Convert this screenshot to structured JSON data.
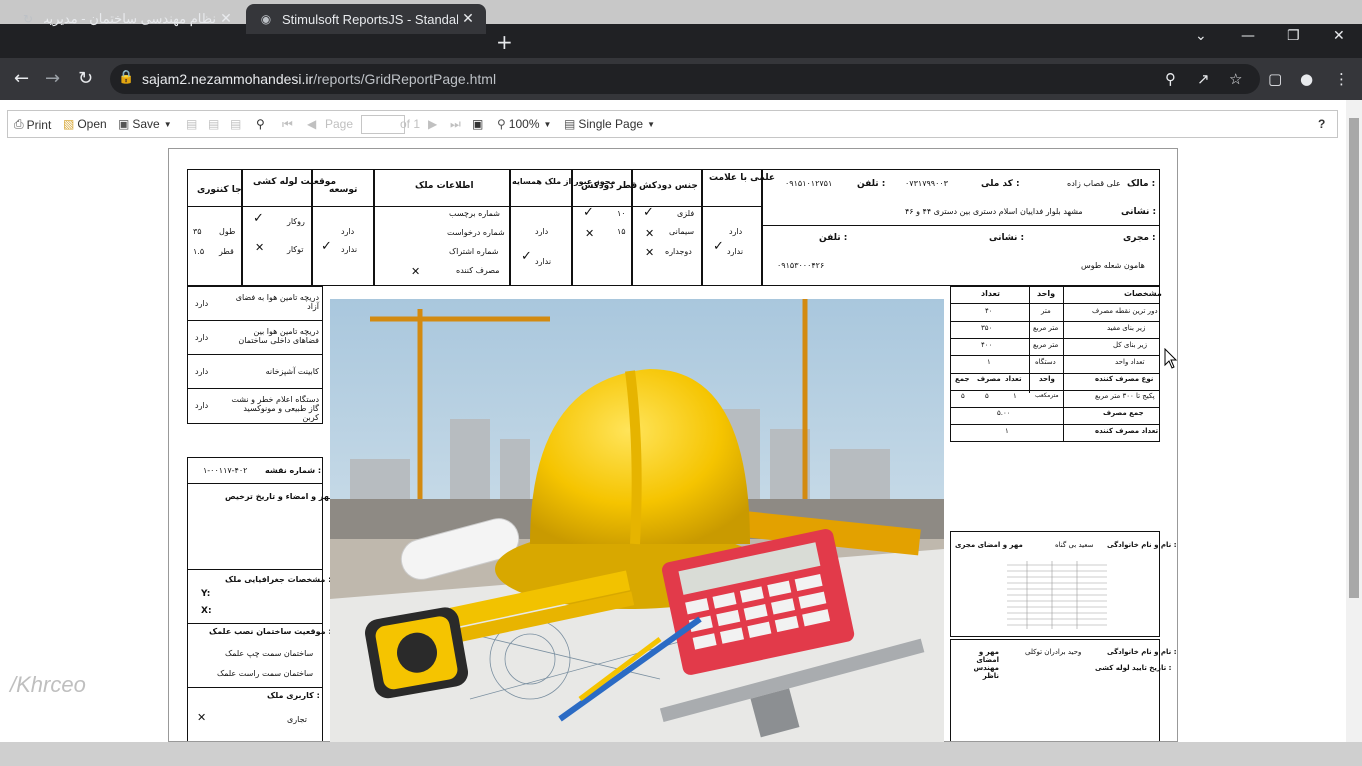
{
  "browser": {
    "tabs": [
      {
        "title": "نظام مهندسی ساختمان - مدیریت پ",
        "active": false
      },
      {
        "title": "Stimulsoft ReportsJS - Standalone",
        "active": true
      }
    ],
    "new_tab": "+",
    "url_domain": "sajam2.nezammohandesi.ir",
    "url_path": "/reports/GridReportPage.html"
  },
  "toolbar": {
    "print": "Print",
    "open": "Open",
    "save": "Save",
    "page_label": "Page",
    "page_value": "",
    "page_of": "of 1",
    "zoom": "100%",
    "view_mode": "Single Page",
    "help": "?"
  },
  "report": {
    "owner": {
      "owner_label": "مالک :",
      "owner_value": "علی قصاب زاده",
      "national_id_label": "کد ملی :",
      "national_id_value": "۰۷۳۱۷۹۹۰۰۳",
      "phone_label": "تلفن :",
      "phone_value": "۰۹۱۵۱۰۱۲۷۵۱",
      "address_label": "نشانی :",
      "address_value": "مشهد بلوار فداییان اسلام دستری بین دستری ۴۴ و ۴۶"
    },
    "executor": {
      "executor_label": "مجری :",
      "executor_value": "هامون شعله طوس",
      "address_label": "نشانی :",
      "phone_label": "تلفن :",
      "phone_value": "۰۹۱۵۳۰۰۰۴۲۶"
    },
    "headers": {
      "sign": "علمی با علامت",
      "chimney_type": "جنس دودکش",
      "chimney_diameter": "قطر دودکش",
      "neighbor_permit": "مجوز عبور از ملک همسایه",
      "property_info": "اطلاعات ملک",
      "development": "توسعه",
      "pipe_position": "موقعیت لوله کشی",
      "meter_place": "جا کنتوری"
    },
    "values": {
      "has": "دارد",
      "has_not": "ندارد",
      "metal": "فلزی",
      "cement": "سیمانی",
      "double_wall": "دوجداره",
      "d10": "۱۰",
      "d15": "۱۵",
      "tag_no": "شماره برچسب",
      "request_no": "شماره درخواست",
      "subscription_no": "شماره اشتراک",
      "consumer": "مصرف کننده",
      "surface": "روکار",
      "concealed": "توکار",
      "length_label": "طول",
      "length_value": "۳۵",
      "diameter_label": "قطر",
      "diameter_value": "۱.۵"
    },
    "specs": {
      "title": "مشخصات",
      "unit": "واحد",
      "count": "تعداد",
      "rows": [
        {
          "label": "دور ترین نقطه مصرف",
          "unit": "متر",
          "value": "۴۰"
        },
        {
          "label": "زیر بنای مفید",
          "unit": "متر مربع",
          "value": "۳۵۰"
        },
        {
          "label": "زیر بنای کل",
          "unit": "متر مربع",
          "value": "۴۰۰"
        },
        {
          "label": "تعداد واحد",
          "unit": "دستگاه",
          "value": "۱"
        }
      ],
      "consumer_type": "نوع مصرف کننده",
      "sum": "جمع",
      "usage": "مصرف",
      "package_label": "پکیج تا ۳۰۰ متر مربع",
      "package_unit": "مترمکعب",
      "package_count": "۱",
      "package_usage": "۵",
      "package_sum": "۵",
      "total_usage_label": "جمع مصرف",
      "total_usage_value": "۵.۰۰",
      "consumer_count_label": "تعداد مصرف کننده",
      "consumer_count_value": "۱"
    },
    "left_list": [
      {
        "label": "دریچه تامین هوا به فضای آزاد",
        "value": "دارد"
      },
      {
        "label": "دریچه تامین هوا بین فضاهای داخلی ساختمان",
        "value": "دارد"
      },
      {
        "label": "کابینت آشپزخانه",
        "value": "دارد"
      },
      {
        "label": "دستگاه اعلام خطر و نشت گاز طبیعی و مونوکسید کربن",
        "value": "دارد"
      }
    ],
    "map_no_label": "شماره نقشه :",
    "map_no_value": "۱-۰۰۱۱۷-۴۰۲",
    "stamp_label": "مهر و امضاء و تاریخ ترخیص",
    "geo_label": "مشخصات جغرافیایی ملک :",
    "y_label": "Y:",
    "x_label": "X:",
    "position_label": "موقعیت ساختمان نصب علمک :",
    "left_side": "ساختمان سمت چپ علمک",
    "right_side": "ساختمان سمت راست علمک",
    "usage_label": "کاربری ملک :",
    "commercial": "تجاری",
    "executor_sign_name_label": "نام و نام خانوادگی :",
    "executor_sign_name": "سعید بی گناه",
    "executor_sign_title": "مهر و امضای مجری",
    "supervisor_name_label": "نام و نام خانوادگی :",
    "supervisor_name": "وحید برادران توکلی",
    "supervisor_title": "مهر و امضای مهندس ناظر",
    "approval_date_label": "تاریخ تایید لوله کشی :"
  },
  "watermark": "/Khrceo",
  "colors": {
    "tab_bg": "#202124",
    "active_tab": "#35363a",
    "helmet": "#f5c400",
    "calculator": "#e23a4a"
  }
}
